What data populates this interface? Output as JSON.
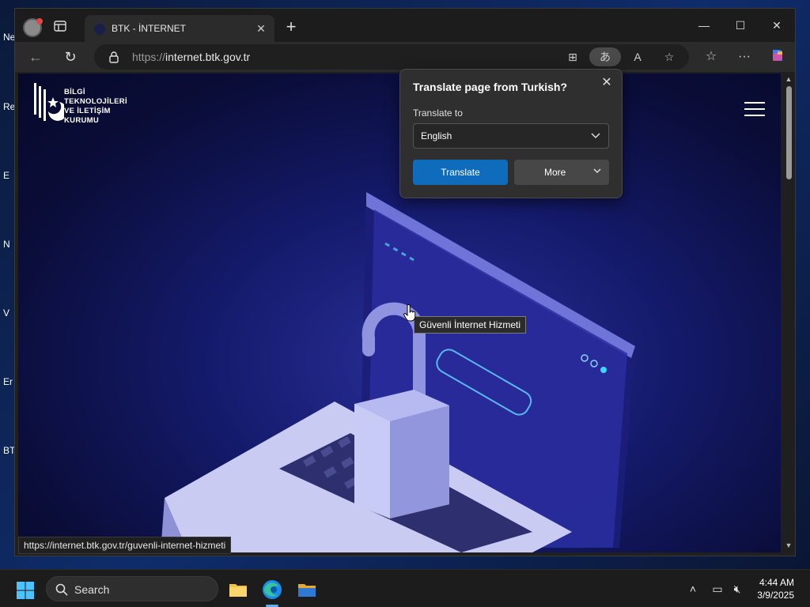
{
  "desktop": {
    "labels": [
      "Ne",
      "Re",
      "E",
      "N",
      "V",
      "Er",
      "BT"
    ]
  },
  "browser": {
    "tab": {
      "title": "BTK - İNTERNET"
    },
    "address": {
      "scheme": "https://",
      "host": "internet.btk.gov.tr"
    },
    "status_url": "https://internet.btk.gov.tr/guvenli-internet-hizmeti"
  },
  "page": {
    "logo_lines": [
      "BİLGİ",
      "TEKNOLOJİLERİ",
      "VE İLETİŞİM",
      "KURUMU"
    ],
    "tooltip": "Güvenli İnternet Hizmeti"
  },
  "translate_popup": {
    "title": "Translate page from Turkish?",
    "label": "Translate to",
    "selected_language": "English",
    "translate_button": "Translate",
    "more_button": "More"
  },
  "taskbar": {
    "search_placeholder": "Search",
    "time": "4:44 AM",
    "date": "3/9/2025"
  },
  "colors": {
    "accent": "#0f6cbd",
    "page_bg": "#141a6a"
  }
}
